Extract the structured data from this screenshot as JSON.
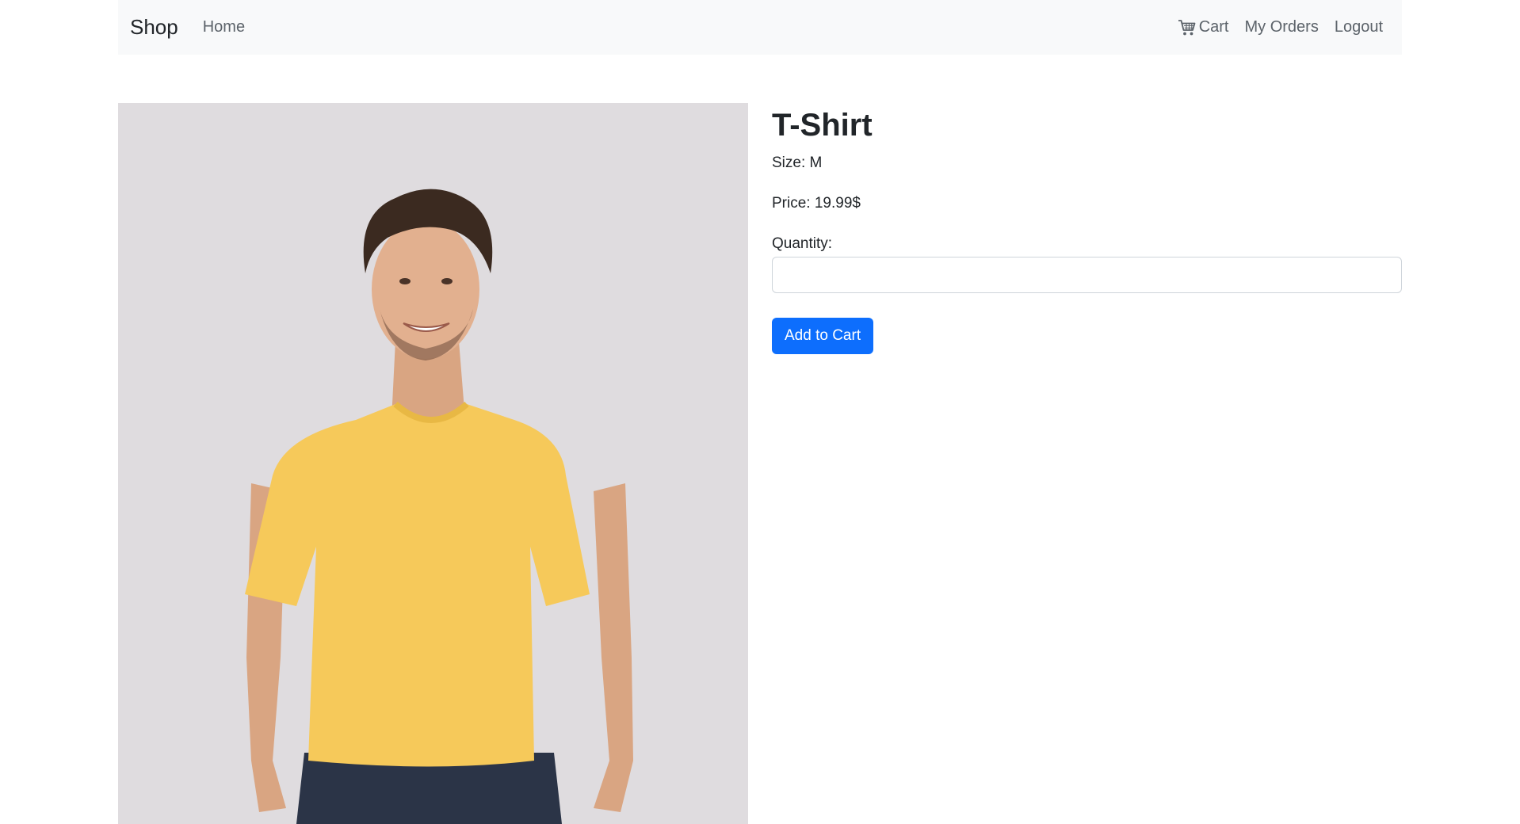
{
  "navbar": {
    "brand": "Shop",
    "home": "Home",
    "cart": "Cart",
    "my_orders": "My Orders",
    "logout": "Logout",
    "cart_icon": "cart-icon"
  },
  "product": {
    "title": "T-Shirt",
    "size_text": "Size: M",
    "price_text": "Price: 19.99$",
    "quantity_label": "Quantity:",
    "quantity_value": "",
    "add_button": "Add to Cart"
  },
  "colors": {
    "primary": "#0d6efd",
    "navbar_bg": "#f8f9fa",
    "photo_bg": "#dfdcdf",
    "shirt": "#f6c95a"
  }
}
